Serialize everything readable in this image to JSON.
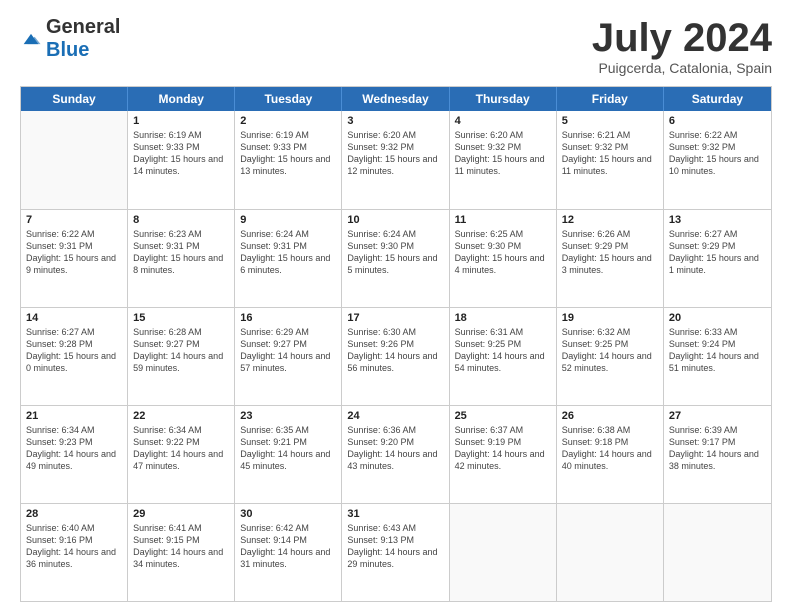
{
  "header": {
    "logo_general": "General",
    "logo_blue": "Blue",
    "month": "July 2024",
    "location": "Puigcerda, Catalonia, Spain"
  },
  "calendar": {
    "days_of_week": [
      "Sunday",
      "Monday",
      "Tuesday",
      "Wednesday",
      "Thursday",
      "Friday",
      "Saturday"
    ],
    "weeks": [
      [
        {
          "day": "",
          "empty": true
        },
        {
          "day": "1",
          "sunrise": "Sunrise: 6:19 AM",
          "sunset": "Sunset: 9:33 PM",
          "daylight": "Daylight: 15 hours and 14 minutes."
        },
        {
          "day": "2",
          "sunrise": "Sunrise: 6:19 AM",
          "sunset": "Sunset: 9:33 PM",
          "daylight": "Daylight: 15 hours and 13 minutes."
        },
        {
          "day": "3",
          "sunrise": "Sunrise: 6:20 AM",
          "sunset": "Sunset: 9:32 PM",
          "daylight": "Daylight: 15 hours and 12 minutes."
        },
        {
          "day": "4",
          "sunrise": "Sunrise: 6:20 AM",
          "sunset": "Sunset: 9:32 PM",
          "daylight": "Daylight: 15 hours and 11 minutes."
        },
        {
          "day": "5",
          "sunrise": "Sunrise: 6:21 AM",
          "sunset": "Sunset: 9:32 PM",
          "daylight": "Daylight: 15 hours and 11 minutes."
        },
        {
          "day": "6",
          "sunrise": "Sunrise: 6:22 AM",
          "sunset": "Sunset: 9:32 PM",
          "daylight": "Daylight: 15 hours and 10 minutes."
        }
      ],
      [
        {
          "day": "7",
          "sunrise": "Sunrise: 6:22 AM",
          "sunset": "Sunset: 9:31 PM",
          "daylight": "Daylight: 15 hours and 9 minutes."
        },
        {
          "day": "8",
          "sunrise": "Sunrise: 6:23 AM",
          "sunset": "Sunset: 9:31 PM",
          "daylight": "Daylight: 15 hours and 8 minutes."
        },
        {
          "day": "9",
          "sunrise": "Sunrise: 6:24 AM",
          "sunset": "Sunset: 9:31 PM",
          "daylight": "Daylight: 15 hours and 6 minutes."
        },
        {
          "day": "10",
          "sunrise": "Sunrise: 6:24 AM",
          "sunset": "Sunset: 9:30 PM",
          "daylight": "Daylight: 15 hours and 5 minutes."
        },
        {
          "day": "11",
          "sunrise": "Sunrise: 6:25 AM",
          "sunset": "Sunset: 9:30 PM",
          "daylight": "Daylight: 15 hours and 4 minutes."
        },
        {
          "day": "12",
          "sunrise": "Sunrise: 6:26 AM",
          "sunset": "Sunset: 9:29 PM",
          "daylight": "Daylight: 15 hours and 3 minutes."
        },
        {
          "day": "13",
          "sunrise": "Sunrise: 6:27 AM",
          "sunset": "Sunset: 9:29 PM",
          "daylight": "Daylight: 15 hours and 1 minute."
        }
      ],
      [
        {
          "day": "14",
          "sunrise": "Sunrise: 6:27 AM",
          "sunset": "Sunset: 9:28 PM",
          "daylight": "Daylight: 15 hours and 0 minutes."
        },
        {
          "day": "15",
          "sunrise": "Sunrise: 6:28 AM",
          "sunset": "Sunset: 9:27 PM",
          "daylight": "Daylight: 14 hours and 59 minutes."
        },
        {
          "day": "16",
          "sunrise": "Sunrise: 6:29 AM",
          "sunset": "Sunset: 9:27 PM",
          "daylight": "Daylight: 14 hours and 57 minutes."
        },
        {
          "day": "17",
          "sunrise": "Sunrise: 6:30 AM",
          "sunset": "Sunset: 9:26 PM",
          "daylight": "Daylight: 14 hours and 56 minutes."
        },
        {
          "day": "18",
          "sunrise": "Sunrise: 6:31 AM",
          "sunset": "Sunset: 9:25 PM",
          "daylight": "Daylight: 14 hours and 54 minutes."
        },
        {
          "day": "19",
          "sunrise": "Sunrise: 6:32 AM",
          "sunset": "Sunset: 9:25 PM",
          "daylight": "Daylight: 14 hours and 52 minutes."
        },
        {
          "day": "20",
          "sunrise": "Sunrise: 6:33 AM",
          "sunset": "Sunset: 9:24 PM",
          "daylight": "Daylight: 14 hours and 51 minutes."
        }
      ],
      [
        {
          "day": "21",
          "sunrise": "Sunrise: 6:34 AM",
          "sunset": "Sunset: 9:23 PM",
          "daylight": "Daylight: 14 hours and 49 minutes."
        },
        {
          "day": "22",
          "sunrise": "Sunrise: 6:34 AM",
          "sunset": "Sunset: 9:22 PM",
          "daylight": "Daylight: 14 hours and 47 minutes."
        },
        {
          "day": "23",
          "sunrise": "Sunrise: 6:35 AM",
          "sunset": "Sunset: 9:21 PM",
          "daylight": "Daylight: 14 hours and 45 minutes."
        },
        {
          "day": "24",
          "sunrise": "Sunrise: 6:36 AM",
          "sunset": "Sunset: 9:20 PM",
          "daylight": "Daylight: 14 hours and 43 minutes."
        },
        {
          "day": "25",
          "sunrise": "Sunrise: 6:37 AM",
          "sunset": "Sunset: 9:19 PM",
          "daylight": "Daylight: 14 hours and 42 minutes."
        },
        {
          "day": "26",
          "sunrise": "Sunrise: 6:38 AM",
          "sunset": "Sunset: 9:18 PM",
          "daylight": "Daylight: 14 hours and 40 minutes."
        },
        {
          "day": "27",
          "sunrise": "Sunrise: 6:39 AM",
          "sunset": "Sunset: 9:17 PM",
          "daylight": "Daylight: 14 hours and 38 minutes."
        }
      ],
      [
        {
          "day": "28",
          "sunrise": "Sunrise: 6:40 AM",
          "sunset": "Sunset: 9:16 PM",
          "daylight": "Daylight: 14 hours and 36 minutes."
        },
        {
          "day": "29",
          "sunrise": "Sunrise: 6:41 AM",
          "sunset": "Sunset: 9:15 PM",
          "daylight": "Daylight: 14 hours and 34 minutes."
        },
        {
          "day": "30",
          "sunrise": "Sunrise: 6:42 AM",
          "sunset": "Sunset: 9:14 PM",
          "daylight": "Daylight: 14 hours and 31 minutes."
        },
        {
          "day": "31",
          "sunrise": "Sunrise: 6:43 AM",
          "sunset": "Sunset: 9:13 PM",
          "daylight": "Daylight: 14 hours and 29 minutes."
        },
        {
          "day": "",
          "empty": true
        },
        {
          "day": "",
          "empty": true
        },
        {
          "day": "",
          "empty": true
        }
      ]
    ]
  }
}
